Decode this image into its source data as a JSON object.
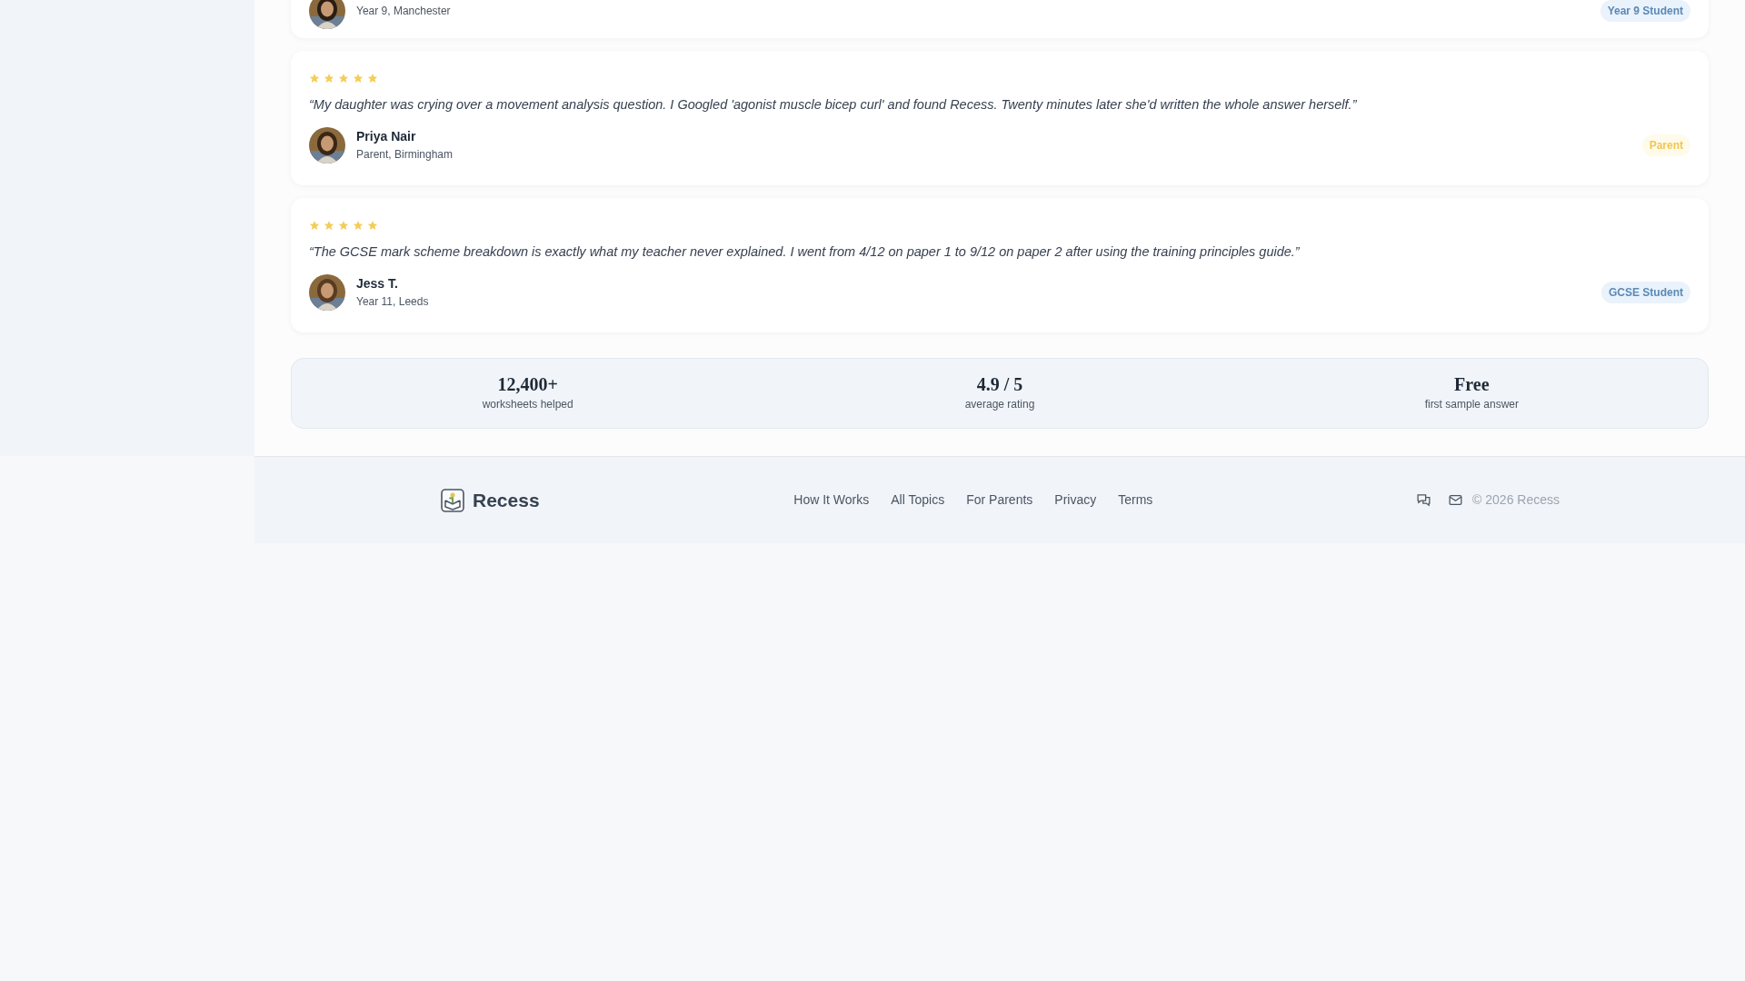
{
  "testimonials": [
    {
      "detail": "Year 9, Manchester",
      "badge": {
        "label": "Year 9 Student",
        "kind": "student"
      }
    },
    {
      "stars": 5,
      "quote": "“My daughter was crying over a movement analysis question. I Googled 'agonist muscle bicep curl' and found Recess. Twenty minutes later she'd written the whole answer herself.”",
      "name": "Priya Nair",
      "detail": "Parent, Birmingham",
      "badge": {
        "label": "Parent",
        "kind": "parent"
      }
    },
    {
      "stars": 5,
      "quote": "“The GCSE mark scheme breakdown is exactly what my teacher never explained. I went from 4/12 on paper 1 to 9/12 on paper 2 after using the training principles guide.”",
      "name": "Jess T.",
      "detail": "Year 11, Leeds",
      "badge": {
        "label": "GCSE Student",
        "kind": "student"
      }
    }
  ],
  "stats": [
    {
      "value": "12,400+",
      "label": "worksheets helped"
    },
    {
      "value": "4.9 / 5",
      "label": "average rating"
    },
    {
      "value": "Free",
      "label": "first sample answer"
    }
  ],
  "footer": {
    "brand": "Recess",
    "links": [
      "How It Works",
      "All Topics",
      "For Parents",
      "Privacy",
      "Terms"
    ],
    "copyright": "© 2026 Recess"
  }
}
